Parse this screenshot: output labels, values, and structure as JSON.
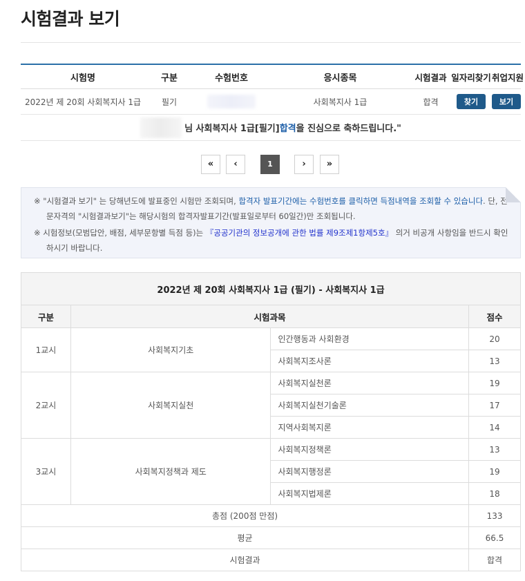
{
  "page": {
    "title": "시험결과 보기"
  },
  "result_table": {
    "headers": [
      "시험명",
      "구분",
      "수험번호",
      "응시종목",
      "시험결과",
      "일자리찾기",
      "취업지원"
    ],
    "row": {
      "exam_name": "2022년 제 20회 사회복지사 1급",
      "type": "필기",
      "field": "사회복지사 1급",
      "result": "합격",
      "job_button": "찾기",
      "support_button": "보기"
    },
    "message": {
      "prefix": "님 사회복지사 1급[필기] ",
      "highlight": "합격",
      "suffix": "을 진심으로 축하드립니다.\""
    }
  },
  "pagination": {
    "first": "«",
    "prev": "‹",
    "current": "1",
    "next": "›",
    "last": "»"
  },
  "notice": {
    "line1_a": "※ \"시험결과 보기\" 는 당해년도에 발표중인 시험만 조회되며, ",
    "line1_link": "합격자 발표기간에는 수험번호를 클릭하면 득점내역을 조회할 수 있습니다",
    "line1_b": ". 단, 전문자격의 \"시험결과보기\"는 해당시험의 합격자발표기간(발표일로부터 60일간)만 조회됩니다.",
    "line2_a": "※ 시험정보(모범답안, 배점, 세부문항별 득점 등)는 ",
    "line2_link": "『공공기관의 정보공개에 관한 법률 제9조제1항제5호』",
    "line2_b": " 의거 비공개 사항임을 반드시 확인하시기 바랍니다."
  },
  "score_table": {
    "caption": "2022년 제 20회 사회복지사 1급 (필기) - 사회복지사 1급",
    "headers": {
      "period": "구분",
      "subject": "시험과목",
      "score": "점수"
    },
    "groups": [
      {
        "period": "1교시",
        "area": "사회복지기초",
        "items": [
          {
            "name": "인간행동과 사회환경",
            "score": "20"
          },
          {
            "name": "사회복지조사론",
            "score": "13"
          }
        ]
      },
      {
        "period": "2교시",
        "area": "사회복지실천",
        "items": [
          {
            "name": "사회복지실천론",
            "score": "19"
          },
          {
            "name": "사회복지실천기술론",
            "score": "17"
          },
          {
            "name": "지역사회복지론",
            "score": "14"
          }
        ]
      },
      {
        "period": "3교시",
        "area": "사회복지정책과 제도",
        "items": [
          {
            "name": "사회복지정책론",
            "score": "13"
          },
          {
            "name": "사회복지행정론",
            "score": "19"
          },
          {
            "name": "사회복지법제론",
            "score": "18"
          }
        ]
      }
    ],
    "summary": {
      "total_label": "총점 (200점 만점)",
      "total": "133",
      "avg_label": "평균",
      "avg": "66.5",
      "result_label": "시험결과",
      "result": "합격"
    }
  }
}
